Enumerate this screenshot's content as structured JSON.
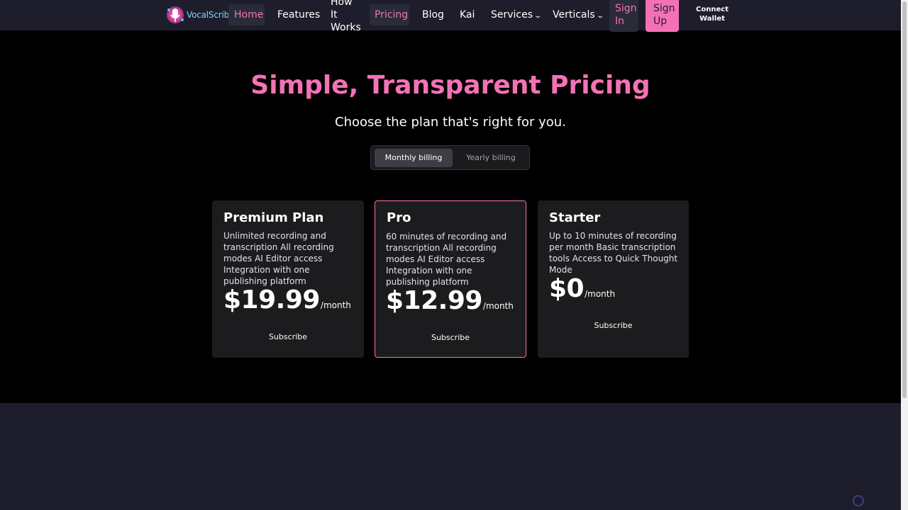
{
  "nav": {
    "brand": "VocalScribe",
    "home": "Home",
    "features": "Features",
    "how_it_works": "How It Works",
    "pricing": "Pricing",
    "blog": "Blog",
    "kai": "Kai",
    "services": "Services",
    "verticals": "Verticals",
    "sign_in": "Sign In",
    "sign_up": "Sign Up",
    "connect_wallet": "Connect Wallet"
  },
  "hero": {
    "title": "Simple, Transparent Pricing",
    "subtitle": "Choose the plan that's right for you."
  },
  "billing": {
    "monthly": "Monthly billing",
    "yearly": "Yearly billing",
    "selected": "Monthly billing"
  },
  "plans": [
    {
      "name": "Premium Plan",
      "description": "Unlimited recording and transcription All recording modes AI Editor access Integration with one publishing platform",
      "price": "$19.99",
      "unit": "/month",
      "cta": "Subscribe"
    },
    {
      "name": "Pro",
      "description": "60 minutes of recording and transcription All recording modes AI Editor access Integration with one publishing platform",
      "price": "$12.99",
      "unit": "/month",
      "cta": "Subscribe"
    },
    {
      "name": "Starter",
      "description": "Up to 10 minutes of recording per month Basic transcription tools Access to Quick Thought Mode",
      "price": "$0",
      "unit": "/month",
      "cta": "Subscribe"
    }
  ],
  "colors": {
    "accent": "#f472b6",
    "nav_bg": "#1e1d2b",
    "card_bg": "#1c1c1f"
  }
}
